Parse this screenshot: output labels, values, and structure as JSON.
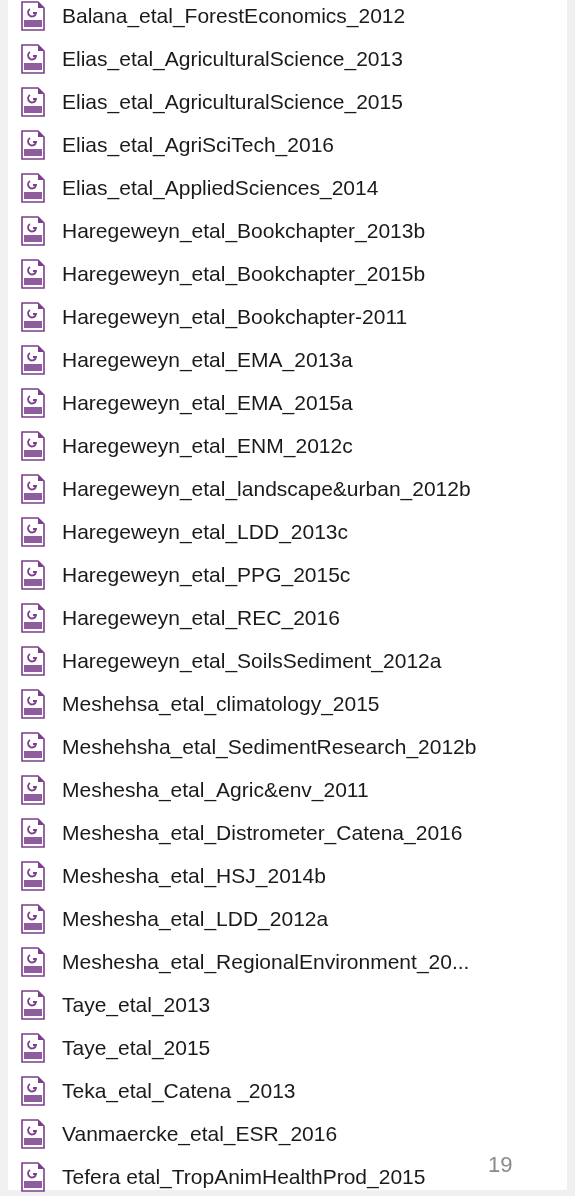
{
  "files": [
    {
      "name": "Balana_etal_ForestEconomics_2012"
    },
    {
      "name": "Elias_etal_AgriculturalScience_2013"
    },
    {
      "name": "Elias_etal_AgriculturalScience_2015"
    },
    {
      "name": "Elias_etal_AgriSciTech_2016"
    },
    {
      "name": "Elias_etal_AppliedSciences_2014"
    },
    {
      "name": "Haregeweyn_etal_Bookchapter_2013b"
    },
    {
      "name": "Haregeweyn_etal_Bookchapter_2015b"
    },
    {
      "name": "Haregeweyn_etal_Bookchapter-2011"
    },
    {
      "name": "Haregeweyn_etal_EMA_2013a"
    },
    {
      "name": "Haregeweyn_etal_EMA_2015a"
    },
    {
      "name": "Haregeweyn_etal_ENM_2012c"
    },
    {
      "name": "Haregeweyn_etal_landscape&urban_2012b"
    },
    {
      "name": "Haregeweyn_etal_LDD_2013c"
    },
    {
      "name": "Haregeweyn_etal_PPG_2015c"
    },
    {
      "name": "Haregeweyn_etal_REC_2016"
    },
    {
      "name": "Haregeweyn_etal_SoilsSediment_2012a"
    },
    {
      "name": "Meshehsa_etal_climatology_2015"
    },
    {
      "name": "Meshehsha_etal_SedimentResearch_2012b"
    },
    {
      "name": "Meshesha_etal_Agric&env_2011"
    },
    {
      "name": "Meshesha_etal_Distrometer_Catena_2016"
    },
    {
      "name": "Meshesha_etal_HSJ_2014b"
    },
    {
      "name": "Meshesha_etal_LDD_2012a"
    },
    {
      "name": "Meshesha_etal_RegionalEnvironment_20..."
    },
    {
      "name": "Taye_etal_2013"
    },
    {
      "name": "Taye_etal_2015"
    },
    {
      "name": "Teka_etal_Catena _2013"
    },
    {
      "name": "Vanmaercke_etal_ESR_2016"
    },
    {
      "name": "Tefera etal_TropAnimHealthProd_2015"
    }
  ],
  "page_number": "19"
}
